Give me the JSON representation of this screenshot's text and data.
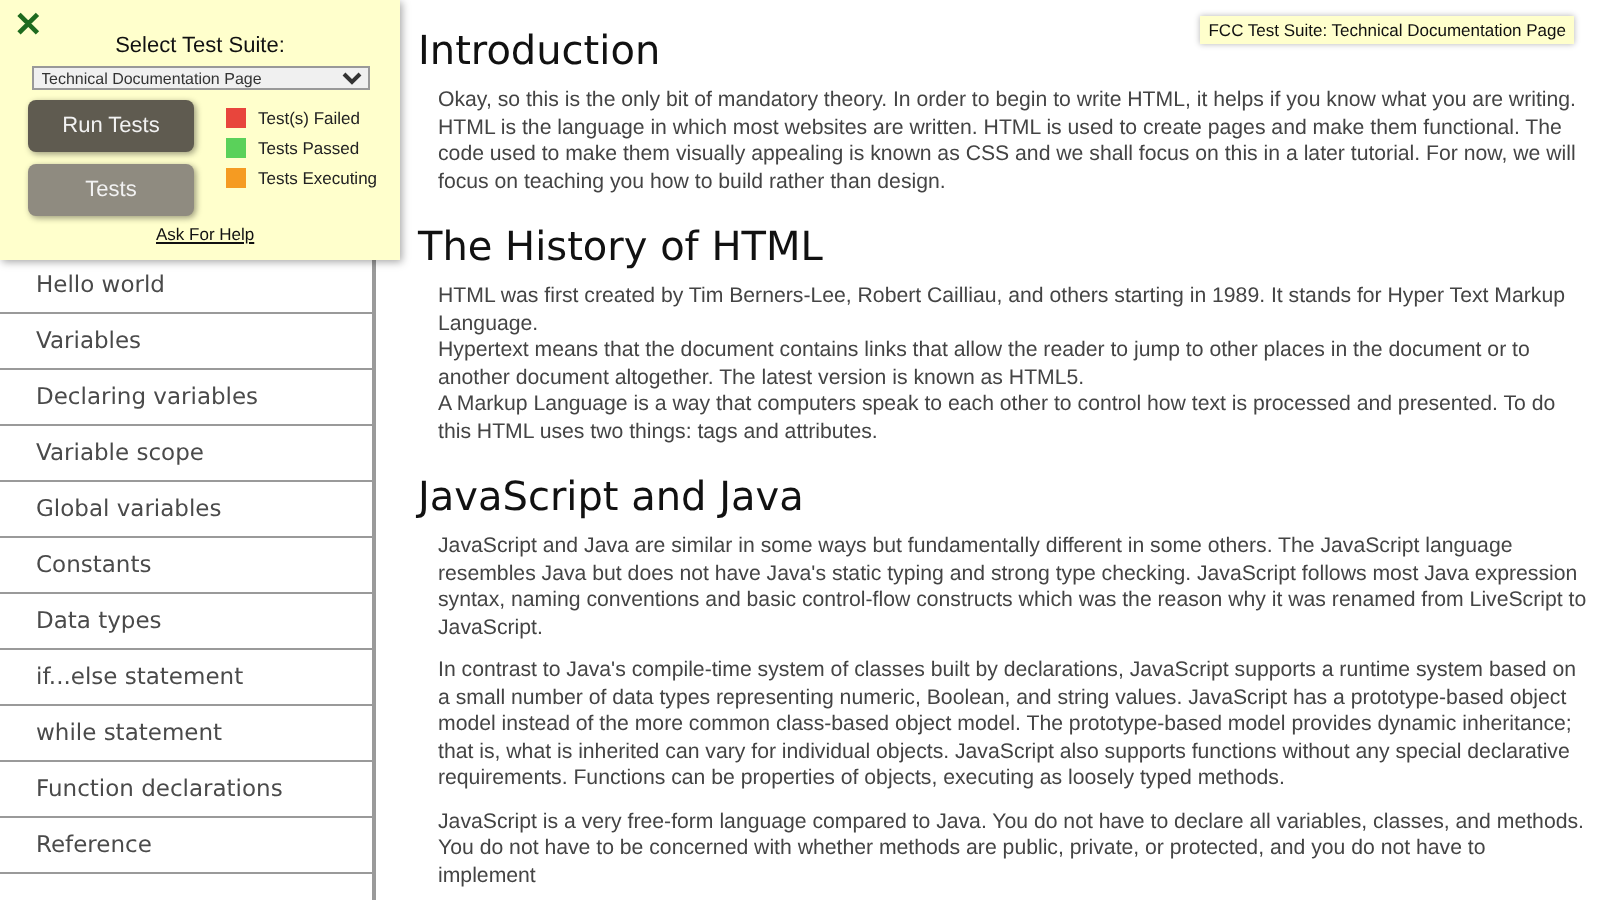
{
  "test_panel": {
    "close": "✕",
    "title": "Select Test Suite:",
    "suite": "Technical Documentation Page",
    "buttons": [
      {
        "label": "Run Tests",
        "kind": "primary"
      },
      {
        "label": "Tests",
        "kind": "secondary"
      }
    ],
    "legend": [
      {
        "label": "Test(s) Failed",
        "color": "#e8453c"
      },
      {
        "label": "Tests Passed",
        "color": "#5ad15a"
      },
      {
        "label": "Tests Executing",
        "color": "#f59b22"
      }
    ],
    "help_link": "Ask For Help"
  },
  "badge": "FCC Test Suite: Technical Documentation Page",
  "sidebar": {
    "items": [
      {
        "label": "Hello world"
      },
      {
        "label": "Variables"
      },
      {
        "label": "Declaring variables"
      },
      {
        "label": "Variable scope"
      },
      {
        "label": "Global variables"
      },
      {
        "label": "Constants"
      },
      {
        "label": "Data types"
      },
      {
        "label": "if...else statement"
      },
      {
        "label": "while statement"
      },
      {
        "label": "Function declarations"
      },
      {
        "label": "Reference"
      }
    ]
  },
  "sections": [
    {
      "heading": "Introduction",
      "paragraphs": [
        "Okay, so this is the only bit of mandatory theory. In order to begin to write HTML, it helps if you know what you are writing. HTML is the language in which most websites are written. HTML is used to create pages and make them functional. The code used to make them visually appealing is known as CSS and we shall focus on this in a later tutorial. For now, we will focus on teaching you how to build rather than design."
      ]
    },
    {
      "heading": "The History of HTML",
      "paragraphs": [
        "HTML was first created by Tim Berners-Lee, Robert Cailliau, and others starting in 1989. It stands for Hyper Text Markup Language.",
        "Hypertext means that the document contains links that allow the reader to jump to other places in the document or to another document altogether. The latest version is known as HTML5.",
        "A Markup Language is a way that computers speak to each other to control how text is processed and presented. To do this HTML uses two things: tags and attributes."
      ],
      "kind": "tight"
    },
    {
      "heading": "JavaScript and Java",
      "paragraphs": [
        "JavaScript and Java are similar in some ways but fundamentally different in some others. The JavaScript language resembles Java but does not have Java's static typing and strong type checking. JavaScript follows most Java expression syntax, naming conventions and basic control-flow constructs which was the reason why it was renamed from LiveScript to JavaScript.",
        "In contrast to Java's compile-time system of classes built by declarations, JavaScript supports a runtime system based on a small number of data types representing numeric, Boolean, and string values. JavaScript has a prototype-based object model instead of the more common class-based object model. The prototype-based model provides dynamic inheritance; that is, what is inherited can vary for individual objects. JavaScript also supports functions without any special declarative requirements. Functions can be properties of objects, executing as loosely typed methods.",
        "JavaScript is a very free-form language compared to Java. You do not have to declare all variables, classes, and methods. You do not have to be concerned with whether methods are public, private, or protected, and you do not have to implement"
      ],
      "kind": "spaced"
    }
  ]
}
